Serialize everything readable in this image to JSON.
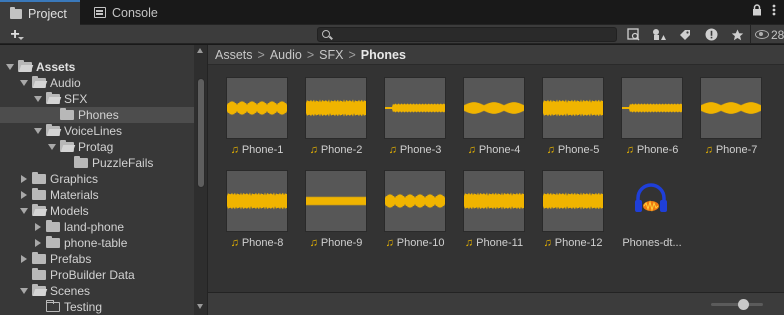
{
  "tabs": [
    {
      "label": "Project",
      "icon": "folder-icon",
      "active": true
    },
    {
      "label": "Console",
      "icon": "console-icon",
      "active": false
    }
  ],
  "toolbar": {
    "create_label": "+",
    "search_value": "",
    "hidden_count": "28"
  },
  "tree": {
    "items": [
      {
        "label": "Assets",
        "depth": 0,
        "arrow": "down",
        "folder": "open",
        "bold": true
      },
      {
        "label": "Audio",
        "depth": 1,
        "arrow": "down",
        "folder": "open"
      },
      {
        "label": "SFX",
        "depth": 2,
        "arrow": "down",
        "folder": "open"
      },
      {
        "label": "Phones",
        "depth": 3,
        "arrow": "none",
        "folder": "closed",
        "selected": true
      },
      {
        "label": "VoiceLines",
        "depth": 2,
        "arrow": "down",
        "folder": "open"
      },
      {
        "label": "Protag",
        "depth": 3,
        "arrow": "down",
        "folder": "open"
      },
      {
        "label": "PuzzleFails",
        "depth": 4,
        "arrow": "none",
        "folder": "closed"
      },
      {
        "label": "Graphics",
        "depth": 1,
        "arrow": "right",
        "folder": "closed"
      },
      {
        "label": "Materials",
        "depth": 1,
        "arrow": "right",
        "folder": "closed"
      },
      {
        "label": "Models",
        "depth": 1,
        "arrow": "down",
        "folder": "open"
      },
      {
        "label": "land-phone",
        "depth": 2,
        "arrow": "right",
        "folder": "closed"
      },
      {
        "label": "phone-table",
        "depth": 2,
        "arrow": "right",
        "folder": "closed"
      },
      {
        "label": "Prefabs",
        "depth": 1,
        "arrow": "right",
        "folder": "closed"
      },
      {
        "label": "ProBuilder Data",
        "depth": 1,
        "arrow": "none",
        "folder": "closed"
      },
      {
        "label": "Scenes",
        "depth": 1,
        "arrow": "down",
        "folder": "open"
      },
      {
        "label": "Testing",
        "depth": 2,
        "arrow": "none",
        "folder": "empty"
      }
    ]
  },
  "breadcrumb": [
    "Assets",
    "Audio",
    "SFX",
    "Phones"
  ],
  "assets": [
    {
      "label": "Phone-1",
      "icon": "audio-clip-icon",
      "wave": "wavy"
    },
    {
      "label": "Phone-2",
      "icon": "audio-clip-icon",
      "wave": "dense"
    },
    {
      "label": "Phone-3",
      "icon": "audio-clip-icon",
      "wave": "thin"
    },
    {
      "label": "Phone-4",
      "icon": "audio-clip-icon",
      "wave": "smooth"
    },
    {
      "label": "Phone-5",
      "icon": "audio-clip-icon",
      "wave": "dense"
    },
    {
      "label": "Phone-6",
      "icon": "audio-clip-icon",
      "wave": "thin"
    },
    {
      "label": "Phone-7",
      "icon": "audio-clip-icon",
      "wave": "smooth"
    },
    {
      "label": "Phone-8",
      "icon": "audio-clip-icon",
      "wave": "dense"
    },
    {
      "label": "Phone-9",
      "icon": "audio-clip-icon",
      "wave": "flat"
    },
    {
      "label": "Phone-10",
      "icon": "audio-clip-icon",
      "wave": "wavy"
    },
    {
      "label": "Phone-11",
      "icon": "audio-clip-icon",
      "wave": "dense"
    },
    {
      "label": "Phone-12",
      "icon": "audio-clip-icon",
      "wave": "dense"
    },
    {
      "label": "Phones-dt...",
      "icon": "audio-mixer-icon",
      "wave": "none"
    }
  ],
  "colors": {
    "accent": "#3a79bb",
    "waveform": "#f0b400",
    "note_icon": "#e8b400",
    "mixer_blue": "#1f3fd8",
    "mixer_orange": "#f07a10"
  }
}
